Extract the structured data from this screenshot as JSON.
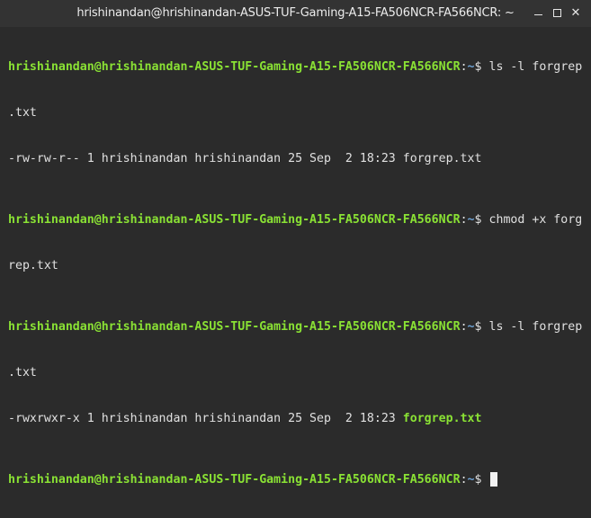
{
  "window": {
    "title": "hrishinandan@hrishinandan-ASUS-TUF-Gaming-A15-FA506NCR-FA566NCR: ~",
    "minimize_icon": "minimize-icon",
    "maximize_icon": "maximize-icon",
    "close_icon": "close-icon"
  },
  "colors": {
    "background": "#2b2b2b",
    "prompt_user": "#8ae234",
    "prompt_path": "#6fa3d6",
    "text": "#e0e0e0"
  },
  "terminal": {
    "prompt_user": "hrishinandan@hrishinandan-ASUS-TUF-Gaming-A15-FA506NCR-FA566NCR",
    "prompt_sep": ":",
    "prompt_path": "~",
    "prompt_end": "$",
    "cmd1_a": " ls -l forgrep",
    "cmd1_b": ".txt",
    "out1": "-rw-rw-r-- 1 hrishinandan hrishinandan 25 Sep  2 18:23 forgrep.txt",
    "cmd2_a": " chmod +x forg",
    "cmd2_b": "rep.txt",
    "cmd3_a": " ls -l forgrep",
    "cmd3_b": ".txt",
    "out2_prefix": "-rwxrwxr-x 1 hrishinandan hrishinandan 25 Sep  2 18:23 ",
    "out2_file": "forgrep.txt"
  }
}
